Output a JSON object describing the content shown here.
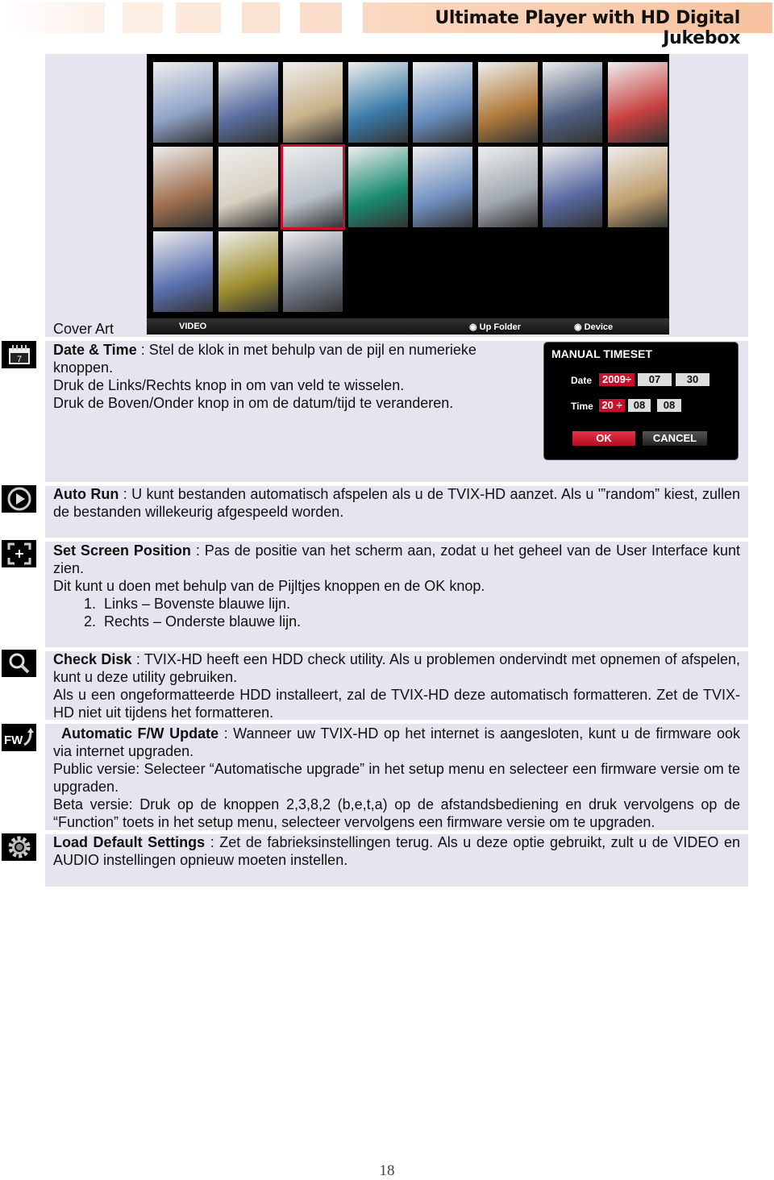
{
  "header": {
    "title": "Ultimate Player with HD Digital Jukebox"
  },
  "cover_art": {
    "label": "Cover Art",
    "bar_left": "VIDEO",
    "up_folder": "Up Folder",
    "device": "Device"
  },
  "manual_timeset": {
    "title": "MANUAL TIMESET",
    "date_label": "Date",
    "year": "2009",
    "month": "07",
    "day": "30",
    "time_label": "Time",
    "hour": "20",
    "minute": "08",
    "second": "08",
    "ok": "OK",
    "cancel": "CANCEL"
  },
  "sections": [
    {
      "icon": "calendar-icon",
      "title": "Date & Time",
      "lines": [
        " : Stel de klok in met behulp van de pijl en numerieke knoppen.",
        "Druk de Links/Rechts knop in om van veld te wisselen.",
        "Druk de Boven/Onder knop in om de datum/tijd te veranderen."
      ]
    },
    {
      "icon": "play-icon",
      "title": "Auto Run",
      "lines": [
        " : U kunt bestanden automatisch afspelen als u de TVIX-HD aanzet. Als u '”random” kiest, zullen de bestanden willekeurig afgespeeld worden."
      ]
    },
    {
      "icon": "screen-position-icon",
      "title": "Set Screen Position",
      "lines": [
        " : Pas de positie van het scherm aan, zodat u het geheel van de User Interface kunt zien.",
        "Dit kunt u doen met behulp van de Pijltjes knoppen en de OK knop.",
        "1.  Links – Bovenste blauwe lijn.",
        "2.  Rechts – Onderste blauwe lijn."
      ]
    },
    {
      "icon": "search-icon",
      "title": "Check Disk",
      "lines": [
        " : TVIX-HD heeft een HDD check utility. Als u problemen ondervindt met opnemen of afspelen, kunt u deze utility gebruiken.",
        "Als u een ongeformatteerde HDD installeert, zal de TVIX-HD deze automatisch formatteren. Zet de TVIX-HD niet uit tijdens het formatteren."
      ]
    },
    {
      "icon": "firmware-update-icon",
      "title": "Automatic F/W Update",
      "lines": [
        " : Wanneer uw TVIX-HD op het internet is aangesloten, kunt u de firmware ook via internet upgraden.",
        "Public versie: Selecteer “Automatische upgrade” in het setup menu en selecteer een firmware versie om te upgraden.",
        "Beta versie: Druk op de knoppen 2,3,8,2 (b,e,t,a) op de afstandsbediening en druk vervolgens op de “Function” toets in het setup menu, selecteer vervolgens een firmware versie om te upgraden."
      ]
    },
    {
      "icon": "gear-icon",
      "title": "Load Default Settings",
      "lines": [
        " : Zet de fabrieksinstellingen terug. Als u deze optie gebruikt, zult u de VIDEO en AUDIO instellingen opnieuw moeten instellen."
      ]
    }
  ],
  "footer": {
    "page_number": "18"
  }
}
